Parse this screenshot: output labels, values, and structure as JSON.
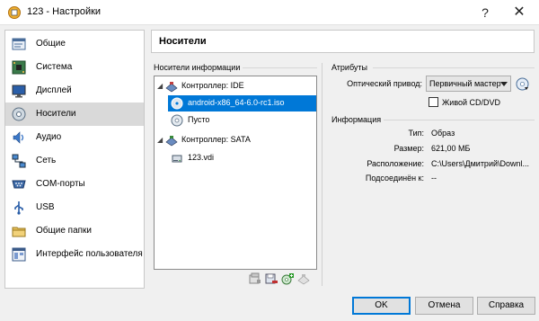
{
  "window": {
    "title": "123 - Настройки",
    "help": "?",
    "close": "✕"
  },
  "sidebar": {
    "items": [
      {
        "label": "Общие",
        "icon": "general-icon"
      },
      {
        "label": "Система",
        "icon": "motherboard-icon"
      },
      {
        "label": "Дисплей",
        "icon": "display-icon"
      },
      {
        "label": "Носители",
        "icon": "storage-icon",
        "selected": true
      },
      {
        "label": "Аудио",
        "icon": "audio-icon"
      },
      {
        "label": "Сеть",
        "icon": "network-icon"
      },
      {
        "label": "COM-порты",
        "icon": "serial-port-icon"
      },
      {
        "label": "USB",
        "icon": "usb-icon"
      },
      {
        "label": "Общие папки",
        "icon": "shared-folder-icon"
      },
      {
        "label": "Интерфейс пользователя",
        "icon": "user-interface-icon"
      }
    ]
  },
  "page": {
    "title": "Носители"
  },
  "storage": {
    "label": "Носители информации",
    "tree": [
      {
        "text": "Контроллер: IDE",
        "type": "controller"
      },
      {
        "text": "android-x86_64-6.0-rc1.iso",
        "type": "optical",
        "selected": true
      },
      {
        "text": "Пусто",
        "type": "optical-empty"
      },
      {
        "text": "Контроллер: SATA",
        "type": "controller"
      },
      {
        "text": "123.vdi",
        "type": "disk"
      }
    ]
  },
  "attributes": {
    "label": "Атрибуты",
    "optical_drive_label": "Оптический привод:",
    "optical_drive_value": "Первичный мастер",
    "live_cd_label": "Живой CD/DVD",
    "live_cd_checked": false
  },
  "information": {
    "label": "Информация",
    "rows": [
      {
        "key": "Тип:",
        "value": "Образ"
      },
      {
        "key": "Размер:",
        "value": "621,00 МБ"
      },
      {
        "key": "Расположение:",
        "value": "C:\\Users\\Дмитрий\\Downl..."
      },
      {
        "key": "Подсоединён к:",
        "value": "--"
      }
    ]
  },
  "buttons": {
    "ok": "OK",
    "cancel": "Отмена",
    "help": "Справка"
  },
  "colors": {
    "selection": "#0078d7",
    "sidebar_selected": "#d9d9d9"
  }
}
